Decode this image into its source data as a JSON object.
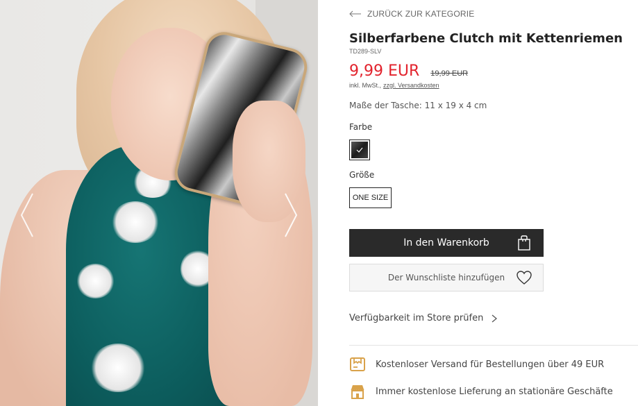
{
  "gallery": {
    "prev_icon": "chevron-left-icon",
    "next_icon": "chevron-right-icon"
  },
  "product": {
    "back_label": "ZURÜCK ZUR KATEGORIE",
    "title": "Silberfarbene Clutch mit Kettenriemen",
    "sku": "TD289-SLV",
    "price": "9,99 EUR",
    "old_price": "19,99 EUR",
    "tax_prefix": "inkl. MwSt.,",
    "shipping_link": "zzgl. Versandkosten",
    "dimensions": "Maße der Tasche: 11 x 19 x 4 cm",
    "color_label": "Farbe",
    "size_label": "Größe",
    "size_option": "ONE SIZE",
    "add_to_cart": "In den Warenkorb",
    "add_to_wishlist": "Der Wunschliste hinzufügen",
    "store_availability": "Verfügbarkeit im Store prüfen"
  },
  "benefits": [
    {
      "icon": "delivery-box-icon",
      "text": "Kostenloser Versand für Bestellungen über 49 EUR"
    },
    {
      "icon": "store-icon",
      "text": "Immer kostenlose Lieferung an stationäre Geschäfte"
    }
  ],
  "colors": {
    "price_red": "#e2232d",
    "button_dark": "#2a2a2a",
    "benefit_icon": "#d9a24a"
  }
}
